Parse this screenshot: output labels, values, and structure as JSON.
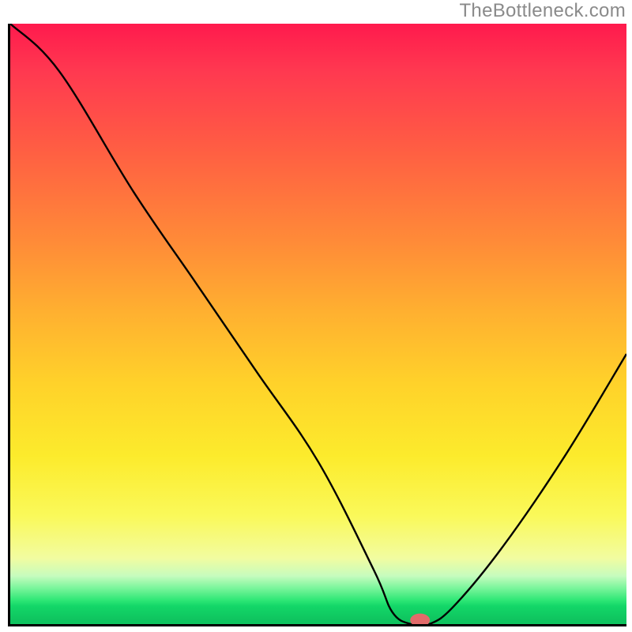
{
  "watermark": "TheBottleneck.com",
  "chart_data": {
    "type": "line",
    "title": "",
    "xlabel": "",
    "ylabel": "",
    "xlim": [
      0,
      100
    ],
    "ylim": [
      0,
      100
    ],
    "series": [
      {
        "name": "bottleneck-curve",
        "x": [
          0,
          8,
          20,
          30,
          40,
          50,
          59,
          62,
          65,
          68,
          72,
          80,
          90,
          100
        ],
        "values": [
          100,
          92,
          72,
          57,
          42,
          27,
          9,
          2,
          0,
          0,
          3,
          13,
          28,
          45
        ]
      }
    ],
    "marker": {
      "name": "optimal-point",
      "x": 66.5,
      "y": 0,
      "rx": 1.6,
      "ry": 1.1,
      "color": "#e26a6a"
    },
    "grid": false,
    "legend": false
  },
  "colors": {
    "curve": "#000000",
    "axis": "#000000",
    "marker_fill": "#e26a6a"
  }
}
